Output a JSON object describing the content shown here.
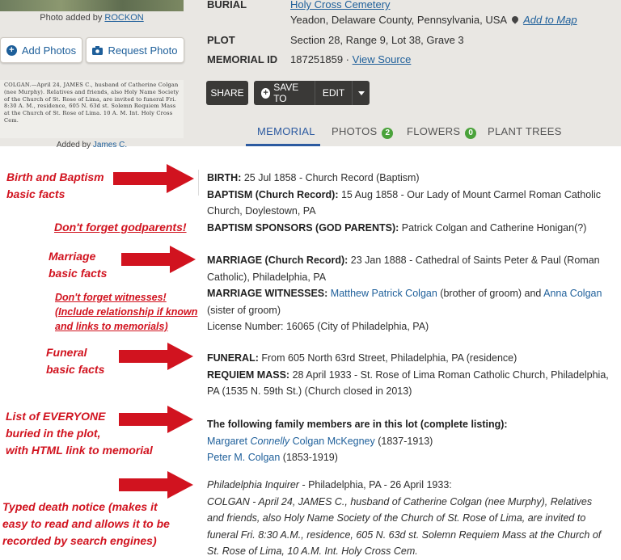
{
  "sidebar": {
    "photo_caption_prefix": "Photo added by ",
    "photo_caption_user": "ROCKON",
    "add_photos": "Add Photos",
    "request_photo": "Request Photo",
    "clipping_text": "COLGAN.—April 24, JAMES C., husband of Catherine Colgan (nee Murphy). Relatives and friends, also Holy Name Society of the Church of St. Rose of Lima, are invited to funeral Fri. 8:30 A. M., residence, 605 N. 63d st. Solemn Requiem Mass at the Church of St. Rose of Lima. 10 A. M. Int. Holy Cross Cem.",
    "clipping_caption_prefix": "Added by ",
    "clipping_caption_user": "James C."
  },
  "details": {
    "burial_label": "BURIAL",
    "burial_cemetery": "Holy Cross Cemetery",
    "burial_location": "Yeadon, Delaware County, Pennsylvania, USA",
    "add_to_map": "Add to Map",
    "plot_label": "PLOT",
    "plot_value": "Section 28, Range 9, Lot 38, Grave 3",
    "memorial_id_label": "MEMORIAL ID",
    "memorial_id_value": "187251859 ·",
    "view_source": "View Source"
  },
  "actions": {
    "share": "SHARE",
    "save_to": "SAVE TO",
    "edit": "EDIT"
  },
  "tabs": {
    "memorial": "MEMORIAL",
    "photos": "PHOTOS",
    "photos_count": "2",
    "flowers": "FLOWERS",
    "flowers_count": "0",
    "plant_trees": "PLANT TREES"
  },
  "annotations": {
    "birth_line1": "Birth and Baptism",
    "birth_line2": "basic facts",
    "godparents": "Don't forget godparents!",
    "marriage_line1": "Marriage",
    "marriage_line2": "basic facts",
    "witness_line1": "Don't forget witnesses!",
    "witness_line2": "(Include relationship if known",
    "witness_line3": "and links to memorials)",
    "funeral_line1": "Funeral",
    "funeral_line2": "basic facts",
    "everyone_line1": "List of EVERYONE",
    "everyone_line2": "buried in the plot,",
    "everyone_line3": "with HTML link to memorial",
    "typed_line1": "Typed death notice (makes it",
    "typed_line2": "easy to read and allows it to be",
    "typed_line3": "recorded by search engines)"
  },
  "bio": {
    "birth_label": "BIRTH:",
    "birth_value": " 25 Jul 1858 - Church Record (Baptism)",
    "baptism_label": "BAPTISM (Church Record):",
    "baptism_value": " 15 Aug 1858 - Our Lady of Mount Carmel Roman Catholic Church, Doylestown, PA",
    "sponsors_label": "BAPTISM SPONSORS (GOD PARENTS):",
    "sponsors_value": " Patrick Colgan and Catherine Honigan(?)",
    "marriage_label": "MARRIAGE (Church Record):",
    "marriage_value": " 23 Jan 1888 - Cathedral of Saints Peter & Paul (Roman Catholic), Philadelphia, PA",
    "witnesses_label": "MARRIAGE WITNESSES:",
    "witness1": "Matthew Patrick Colgan",
    "witness1_note": " (brother of groom) and ",
    "witness2": "Anna Colgan",
    "witness2_note": " (sister of groom)",
    "license": "License Number: 16065 (City of Philadelphia, PA)",
    "funeral_label": "FUNERAL:",
    "funeral_value": " From 605 North 63rd Street, Philadelphia, PA (residence)",
    "mass_label": "REQUIEM MASS:",
    "mass_value": " 28 April 1933 - St. Rose of Lima Roman Catholic Church, Philadelphia, PA (1535 N. 59th St.) (Church closed in 2013)",
    "lot_heading": "The following family members are in this lot (complete listing):",
    "member1_first": "Margaret ",
    "member1_maiden": "Connelly",
    "member1_last": " Colgan McKegney",
    "member1_years": " (1837-1913)",
    "member2_name": "Peter M. Colgan",
    "member2_years": " (1853-1919)",
    "notice_source": "Philadelphia Inquirer",
    "notice_source_rest": " - Philadelphia, PA - 26 April 1933:",
    "notice_text": "COLGAN - April 24, JAMES C., husband of Catherine Colgan (nee Murphy), Relatives and friends, also Holy Name Society of the Church of St. Rose of Lima, are invited to funeral Fri. 8:30 A.M., residence, 605 N. 63d st. Solemn Requiem Mass at the Church of St. Rose of Lima, 10 A.M. Int. Holy Cross Cem."
  },
  "colors": {
    "accent_red": "#d1131f",
    "link_blue": "#1e5f9a",
    "tab_blue": "#2c5aa0",
    "badge_green": "#4aa23a",
    "dark_button": "#3a3937"
  },
  "icons": {
    "map_pin": "map-pin-icon",
    "plus": "plus-icon",
    "camera": "camera-icon",
    "caret": "caret-down-icon"
  }
}
